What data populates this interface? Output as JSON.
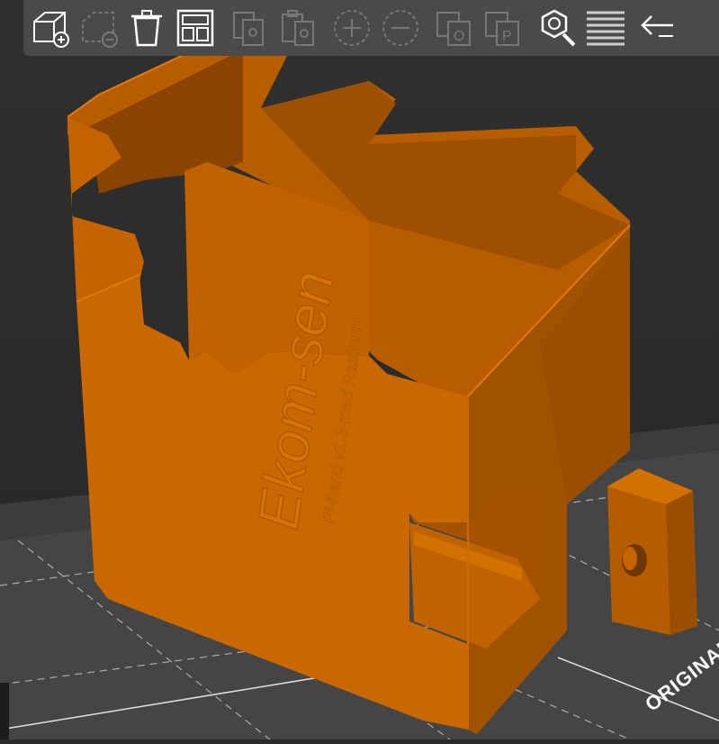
{
  "toolbar": {
    "buttons": [
      {
        "id": "add",
        "icon": "add-object-icon",
        "enabled": true
      },
      {
        "id": "delete",
        "icon": "delete-object-icon",
        "enabled": false
      },
      {
        "id": "delete-all",
        "icon": "trash-icon",
        "enabled": true
      },
      {
        "id": "arrange",
        "icon": "arrange-icon",
        "enabled": true
      },
      {
        "id": "copy",
        "icon": "copy-icon",
        "enabled": false
      },
      {
        "id": "paste",
        "icon": "paste-icon",
        "enabled": false
      },
      {
        "id": "add-instance",
        "icon": "plus-icon",
        "enabled": false
      },
      {
        "id": "remove-instance",
        "icon": "minus-icon",
        "enabled": false
      },
      {
        "id": "split-objects",
        "icon": "split-objects-icon",
        "enabled": false
      },
      {
        "id": "split-parts",
        "icon": "split-parts-icon",
        "enabled": false
      },
      {
        "id": "search",
        "icon": "search-icon",
        "enabled": true
      },
      {
        "id": "layers",
        "icon": "layers-icon",
        "enabled": true
      },
      {
        "id": "undo",
        "icon": "undo-arrow-icon",
        "enabled": true
      }
    ]
  },
  "model": {
    "emboss_main": "Ekom-sen",
    "emboss_sub": "Pi-hand v1.3 med Rasberry",
    "color": "#c86400"
  },
  "bed": {
    "origin_label": "ORIGINAL"
  }
}
